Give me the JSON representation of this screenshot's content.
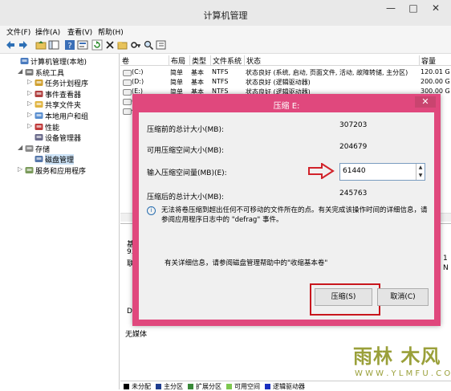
{
  "window": {
    "title": "计算机管理",
    "minimize": "—",
    "maximize": "□",
    "close": "✕"
  },
  "menu": [
    "文件(F)",
    "操作(A)",
    "查看(V)",
    "帮助(H)"
  ],
  "toolbar_icons": [
    "back-icon",
    "forward-icon",
    "up-folder-icon",
    "console-tree-icon",
    "help-icon",
    "properties-icon",
    "refresh-icon",
    "delete-icon",
    "open-folder-icon",
    "key-icon",
    "search-icon",
    "export-icon"
  ],
  "tree": [
    {
      "label": "计算机管理(本地)",
      "level": 0,
      "twisty": "",
      "icon": "computer-icon"
    },
    {
      "label": "系统工具",
      "level": 1,
      "twisty": "◢",
      "icon": "tools-icon"
    },
    {
      "label": "任务计划程序",
      "level": 2,
      "twisty": "▷",
      "icon": "clock-icon"
    },
    {
      "label": "事件查看器",
      "level": 2,
      "twisty": "▷",
      "icon": "event-viewer-icon"
    },
    {
      "label": "共享文件夹",
      "level": 2,
      "twisty": "▷",
      "icon": "shared-folder-icon"
    },
    {
      "label": "本地用户和组",
      "level": 2,
      "twisty": "▷",
      "icon": "users-icon"
    },
    {
      "label": "性能",
      "level": 2,
      "twisty": "▷",
      "icon": "performance-icon"
    },
    {
      "label": "设备管理器",
      "level": 2,
      "twisty": "",
      "icon": "device-manager-icon"
    },
    {
      "label": "存储",
      "level": 1,
      "twisty": "◢",
      "icon": "storage-icon"
    },
    {
      "label": "磁盘管理",
      "level": 2,
      "twisty": "",
      "icon": "disk-management-icon",
      "selected": true
    },
    {
      "label": "服务和应用程序",
      "level": 1,
      "twisty": "▷",
      "icon": "services-icon"
    }
  ],
  "columns": [
    "卷",
    "布局",
    "类型",
    "文件系统",
    "状态",
    "容量"
  ],
  "volumes": [
    {
      "name": "(C:)",
      "layout": "简单",
      "type": "基本",
      "fs": "NTFS",
      "status": "状态良好 (系统, 启动, 页面文件, 活动, 故障转储, 主分区)",
      "capacity": "120.01 G"
    },
    {
      "name": "(D:)",
      "layout": "简单",
      "type": "基本",
      "fs": "NTFS",
      "status": "状态良好 (逻辑驱动器)",
      "capacity": "200.00 G"
    },
    {
      "name": "(E:)",
      "layout": "简单",
      "type": "基本",
      "fs": "NTFS",
      "status": "状态良好 (逻辑驱动器)",
      "capacity": "300.00 G"
    },
    {
      "name": "(F:)",
      "layout": "",
      "type": "",
      "fs": "",
      "status": "",
      "capacity": ""
    },
    {
      "name": "保",
      "layout": "",
      "type": "",
      "fs": "",
      "status": "",
      "capacity": ""
    }
  ],
  "lower": {
    "disk0_lines": [
      "基本",
      "931",
      "联机"
    ],
    "cdrom_lines": [
      "DV",
      "无媒体"
    ],
    "right_edge": [
      "1",
      "N"
    ]
  },
  "legend": [
    {
      "label": "未分配",
      "color": "#000000"
    },
    {
      "label": "主分区",
      "color": "#1f3d8f"
    },
    {
      "label": "扩展分区",
      "color": "#3a8a3a"
    },
    {
      "label": "可用空间",
      "color": "#7ec850"
    },
    {
      "label": "逻辑驱动器",
      "color": "#1a2fbf"
    }
  ],
  "dialog": {
    "title": "压缩 E:",
    "close": "✕",
    "rows": [
      {
        "label": "压缩前的总计大小(MB):",
        "value": "307203"
      },
      {
        "label": "可用压缩空间大小(MB):",
        "value": "204679"
      },
      {
        "label": "输入压缩空间量(MB)(E):",
        "value": "61440"
      },
      {
        "label": "压缩后的总计大小(MB):",
        "value": "245763"
      }
    ],
    "info_text_1": "无法将卷压缩到超出任何不可移动的文件所在的点。有关完成该操作时间的详细信息，请",
    "info_text_2": "参阅应用程序日志中的 \"defrag\" 事件。",
    "help_text": "有关详细信息，请参阅磁盘管理帮助中的\"收缩基本卷\"",
    "compress_button": "压缩(S)",
    "cancel_button": "取消(C)",
    "accent_color": "#e0487d"
  },
  "watermark": {
    "title": "雨林 木风",
    "url": "W W W . Y L M F U . C O M"
  }
}
